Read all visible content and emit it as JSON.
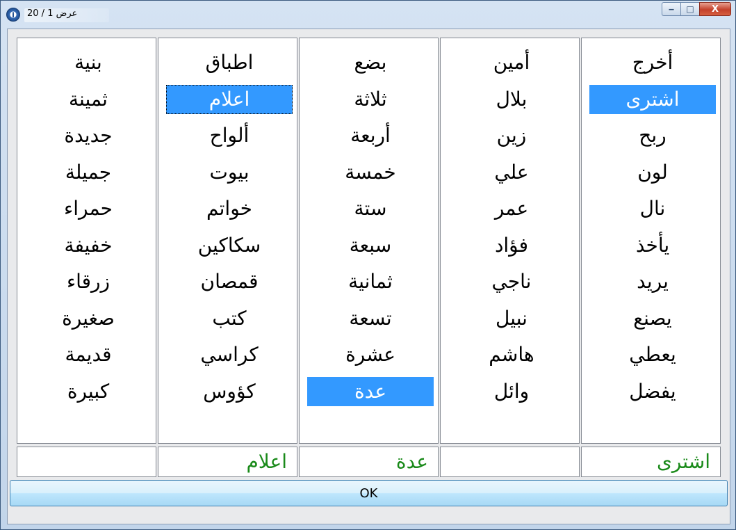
{
  "window": {
    "title": "عرض 1 / 20",
    "info_icon": "info-icon",
    "controls": {
      "minimize": "‒",
      "maximize": "□",
      "close": "X"
    }
  },
  "columns": [
    {
      "items": [
        "أخرج",
        "اشترى",
        "ربح",
        "لون",
        "نال",
        "يأخذ",
        "يريد",
        "يصنع",
        "يعطي",
        "يفضل"
      ],
      "selected_index": 1
    },
    {
      "items": [
        "أمين",
        "بلال",
        "زين",
        "علي",
        "عمر",
        "فؤاد",
        "ناجي",
        "نبيل",
        "هاشم",
        "وائل"
      ],
      "selected_index": -1
    },
    {
      "items": [
        "بضع",
        "ثلاثة",
        "أربعة",
        "خمسة",
        "ستة",
        "سبعة",
        "ثمانية",
        "تسعة",
        "عشرة",
        "عدة"
      ],
      "selected_index": 9
    },
    {
      "items": [
        "اطباق",
        "اعلام",
        "ألواح",
        "بيوت",
        "خواتم",
        "سكاكين",
        "قمصان",
        "كتب",
        "كراسي",
        "كؤوس"
      ],
      "selected_index": 1,
      "focused": true
    },
    {
      "items": [
        "بنية",
        "ثمينة",
        "جديدة",
        "جميلة",
        "حمراء",
        "خفيفة",
        "زرقاء",
        "صغيرة",
        "قديمة",
        "كبيرة"
      ],
      "selected_index": -1
    }
  ],
  "answers": [
    "اشترى",
    "",
    "عدة",
    "اعلام",
    ""
  ],
  "ok_label": "OK",
  "colors": {
    "selection": "#3399ff",
    "answer_text": "#1a8a1a"
  }
}
